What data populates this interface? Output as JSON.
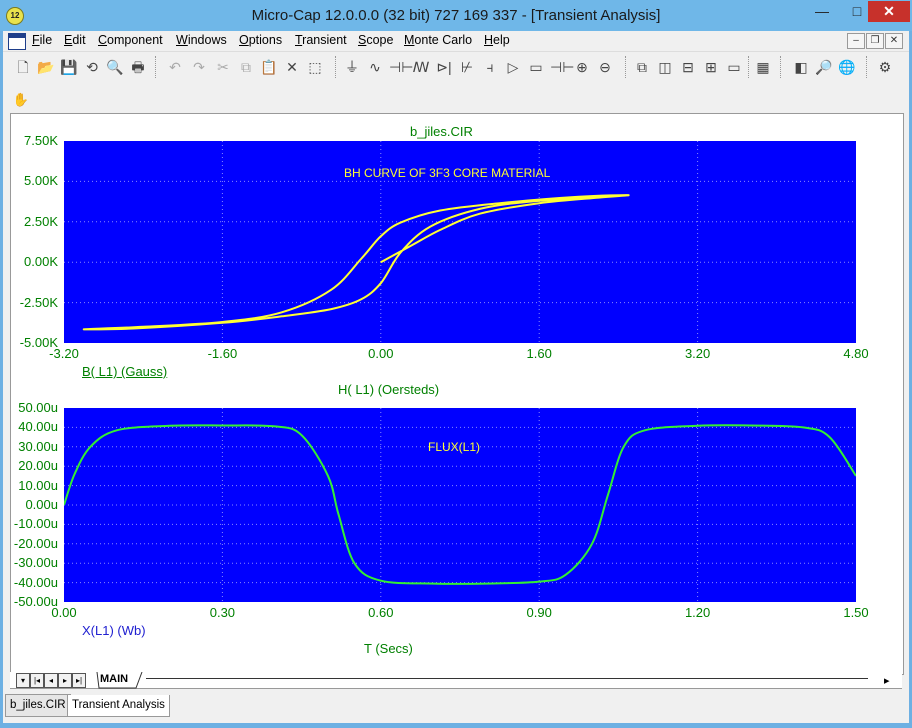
{
  "window": {
    "title": "Micro-Cap 12.0.0.0 (32 bit) 727 169 337 - [Transient Analysis]",
    "icon_text": "12",
    "minimize": "—",
    "maximize": "□",
    "close": "✕"
  },
  "menu": {
    "items": [
      {
        "ul": "F",
        "rest": "ile"
      },
      {
        "ul": "E",
        "rest": "dit"
      },
      {
        "ul": "C",
        "rest": "omponent"
      },
      {
        "ul": "W",
        "rest": "indows"
      },
      {
        "ul": "O",
        "rest": "ptions"
      },
      {
        "ul": "T",
        "rest": "ransient"
      },
      {
        "ul": "S",
        "rest": "cope"
      },
      {
        "ul": "M",
        "rest": "onte Carlo"
      },
      {
        "ul": "H",
        "rest": "elp"
      }
    ],
    "mdi_min": "–",
    "mdi_restore": "❐",
    "mdi_close": "✕"
  },
  "plot": {
    "file_title": "b_jiles.CIR",
    "top": {
      "annotation": "BH CURVE OF 3F3 CORE MATERIAL",
      "y_ticks": [
        "7.50K",
        "5.00K",
        "2.50K",
        "0.00K",
        "-2.50K",
        "-5.00K"
      ],
      "x_ticks": [
        "-3.20",
        "-1.60",
        "0.00",
        "1.60",
        "3.20",
        "4.80"
      ],
      "y_label": "B( L1) (Gauss)",
      "x_label": "H( L1) (Oersteds)",
      "curve_color": "#ffff33",
      "background": "#0000ff"
    },
    "bottom": {
      "annotation": "FLUX(L1)",
      "y_ticks": [
        "50.00u",
        "40.00u",
        "30.00u",
        "20.00u",
        "10.00u",
        "0.00u",
        "-10.00u",
        "-20.00u",
        "-30.00u",
        "-40.00u",
        "-50.00u"
      ],
      "x_ticks": [
        "0.00",
        "0.30",
        "0.60",
        "0.90",
        "1.20",
        "1.50"
      ],
      "y_label": "X(L1) (Wb)",
      "x_label": "T (Secs)",
      "curve_color": "#33ee33",
      "background": "#0000ff"
    }
  },
  "chart_data": [
    {
      "type": "line",
      "title": "BH CURVE OF 3F3 CORE MATERIAL",
      "xlabel": "H( L1) (Oersteds)",
      "ylabel": "B( L1) (Gauss)",
      "xlim": [
        -3.2,
        4.8
      ],
      "ylim": [
        -5000,
        7500
      ],
      "grid": true,
      "series": [
        {
          "name": "B( L1) (Gauss)",
          "x": [
            0.0,
            0.3,
            0.6,
            1.0,
            1.6,
            2.2,
            2.5,
            2.0,
            1.2,
            0.6,
            0.2,
            0.0,
            -0.2,
            -0.5,
            -1.0,
            -1.6,
            -2.4,
            -3.0,
            -2.5,
            -1.6,
            -1.0,
            -0.5,
            -0.2,
            0.0,
            0.2,
            0.5,
            1.0,
            1.6,
            2.5
          ],
          "y": [
            0,
            1000,
            2000,
            3000,
            3650,
            4000,
            4150,
            4050,
            3650,
            3200,
            2450,
            1600,
            200,
            -1700,
            -3100,
            -3700,
            -4000,
            -4150,
            -4100,
            -3750,
            -3350,
            -2900,
            -2300,
            -1300,
            600,
            2200,
            3300,
            3800,
            4150
          ]
        }
      ]
    },
    {
      "type": "line",
      "title": "FLUX(L1)",
      "xlabel": "T (Secs)",
      "ylabel": "X(L1) (Wb)",
      "xlim": [
        0,
        1.5
      ],
      "ylim": [
        -5e-05,
        5e-05
      ],
      "grid": true,
      "series": [
        {
          "name": "FLUX(L1)",
          "x": [
            0.0,
            0.02,
            0.05,
            0.1,
            0.2,
            0.3,
            0.4,
            0.45,
            0.5,
            0.52,
            0.55,
            0.6,
            0.7,
            0.8,
            0.9,
            0.95,
            1.0,
            1.03,
            1.06,
            1.1,
            1.2,
            1.3,
            1.4,
            1.45,
            1.5
          ],
          "y": [
            0.0,
            1.6e-05,
            3e-05,
            3.85e-05,
            4.08e-05,
            4.1e-05,
            4.05e-05,
            3.6e-05,
            1.5e-05,
            -5e-06,
            -3e-05,
            -3.9e-05,
            -4.05e-05,
            -4.05e-05,
            -3.95e-05,
            -3.6e-05,
            -2e-05,
            5e-06,
            3e-05,
            3.85e-05,
            4.08e-05,
            4.1e-05,
            4e-05,
            3.5e-05,
            1.5e-05
          ]
        }
      ]
    }
  ],
  "bottom": {
    "page_tab": "MAIN",
    "doc_tabs": [
      "b_jiles.CIR",
      "Transient Analysis"
    ]
  }
}
